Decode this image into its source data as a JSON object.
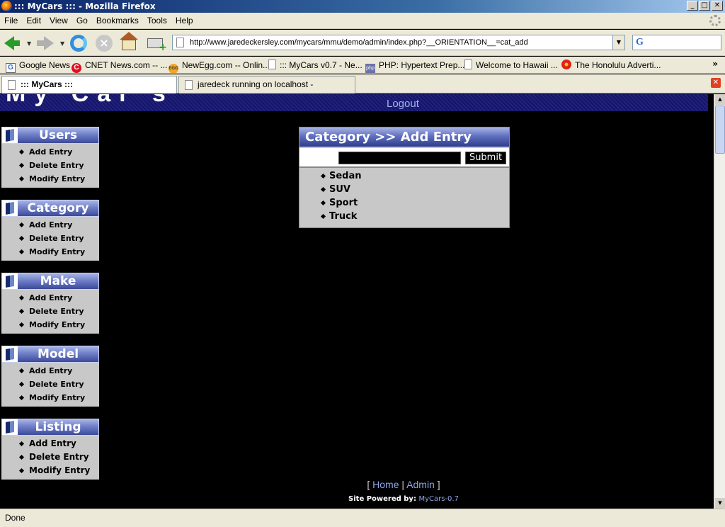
{
  "window": {
    "title": "::: MyCars ::: - Mozilla Firefox",
    "minimize": "_",
    "maximize": "□",
    "close": "✕"
  },
  "menu": [
    "File",
    "Edit",
    "View",
    "Go",
    "Bookmarks",
    "Tools",
    "Help"
  ],
  "urlbar": {
    "url": "http://www.jaredeckersley.com/mycars/mmu/demo/admin/index.php?__ORIENTATION__=cat_add"
  },
  "searchbar": {
    "engine_icon": "G"
  },
  "bookmarks": [
    {
      "label": "Google News",
      "icon": "google-icon"
    },
    {
      "label": "CNET News.com -- ...",
      "icon": "cnet-icon"
    },
    {
      "label": "NewEgg.com -- Onlin...",
      "icon": "newegg-icon"
    },
    {
      "label": "::: MyCars v0.7 - Ne...",
      "icon": "page-icon"
    },
    {
      "label": "PHP: Hypertext Prep...",
      "icon": "php-icon"
    },
    {
      "label": "Welcome to Hawaii ...",
      "icon": "page-icon"
    },
    {
      "label": "The Honolulu Adverti...",
      "icon": "flower-icon"
    }
  ],
  "bookmarks_more": "»",
  "tabs": [
    {
      "label": "::: MyCars :::",
      "active": true
    },
    {
      "label": "jaredeck running on localhost - phpMyAdmin...",
      "active": false
    }
  ],
  "site": {
    "logout": "Logout",
    "panels": [
      {
        "title": "Users",
        "items": [
          "Add Entry",
          "Delete Entry",
          "Modify Entry"
        ]
      },
      {
        "title": "Category",
        "items": [
          "Add Entry",
          "Delete Entry",
          "Modify Entry"
        ]
      },
      {
        "title": "Make",
        "items": [
          "Add Entry",
          "Delete Entry",
          "Modify Entry"
        ]
      },
      {
        "title": "Model",
        "items": [
          "Add Entry",
          "Delete Entry",
          "Modify Entry"
        ]
      },
      {
        "title": "Listing",
        "items": [
          "Add Entry",
          "Delete Entry",
          "Modify Entry"
        ]
      }
    ],
    "main": {
      "title": "Category >> Add Entry",
      "input_value": "",
      "submit": "Submit",
      "categories": [
        "Sedan",
        "SUV",
        "Sport",
        "Truck"
      ]
    },
    "footer": {
      "open": "[",
      "home": "Home",
      "sep": "|",
      "admin": "Admin",
      "close": "]",
      "powered_prefix": "Site Powered by:",
      "powered_link": "MyCars-0.7"
    }
  },
  "status": "Done"
}
